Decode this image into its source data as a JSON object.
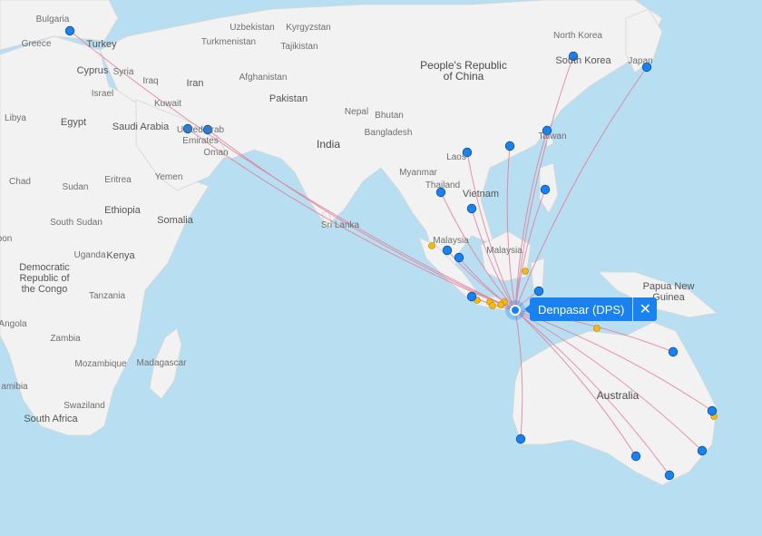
{
  "map": {
    "hub": {
      "name": "Denpasar (DPS)",
      "close_label": "✕"
    },
    "labels": [
      {
        "key": "bulgaria",
        "text": "Bulgaria",
        "cls": ""
      },
      {
        "key": "greece",
        "text": "Greece",
        "cls": ""
      },
      {
        "key": "turkey",
        "text": "Turkey",
        "cls": "country"
      },
      {
        "key": "cyprus",
        "text": "Cyprus",
        "cls": "country"
      },
      {
        "key": "syria",
        "text": "Syria",
        "cls": ""
      },
      {
        "key": "iraq",
        "text": "Iraq",
        "cls": ""
      },
      {
        "key": "israel",
        "text": "Israel",
        "cls": ""
      },
      {
        "key": "iran",
        "text": "Iran",
        "cls": "country"
      },
      {
        "key": "kuwait",
        "text": "Kuwait",
        "cls": ""
      },
      {
        "key": "libya",
        "text": "Libya",
        "cls": ""
      },
      {
        "key": "egypt",
        "text": "Egypt",
        "cls": "country"
      },
      {
        "key": "saudi",
        "text": "Saudi Arabia",
        "cls": "country"
      },
      {
        "key": "uae",
        "text": "United Arab\nEmirates",
        "cls": ""
      },
      {
        "key": "oman",
        "text": "Oman",
        "cls": ""
      },
      {
        "key": "yemen",
        "text": "Yemen",
        "cls": ""
      },
      {
        "key": "uzbekistan",
        "text": "Uzbekistan",
        "cls": ""
      },
      {
        "key": "kyrgyzstan",
        "text": "Kyrgyzstan",
        "cls": ""
      },
      {
        "key": "turkmenistan",
        "text": "Turkmenistan",
        "cls": ""
      },
      {
        "key": "tajikistan",
        "text": "Tajikistan",
        "cls": ""
      },
      {
        "key": "afghanistan",
        "text": "Afghanistan",
        "cls": ""
      },
      {
        "key": "pakistan",
        "text": "Pakistan",
        "cls": "country"
      },
      {
        "key": "nepal",
        "text": "Nepal",
        "cls": ""
      },
      {
        "key": "bhutan",
        "text": "Bhutan",
        "cls": ""
      },
      {
        "key": "india",
        "text": "India",
        "cls": "big"
      },
      {
        "key": "bangladesh",
        "text": "Bangladesh",
        "cls": ""
      },
      {
        "key": "china",
        "text": "People's Republic\nof China",
        "cls": "big"
      },
      {
        "key": "nkorea",
        "text": "North Korea",
        "cls": ""
      },
      {
        "key": "skorea",
        "text": "South Korea",
        "cls": "country"
      },
      {
        "key": "japan",
        "text": "Japan",
        "cls": ""
      },
      {
        "key": "taiwan",
        "text": "Taiwan",
        "cls": ""
      },
      {
        "key": "myanmar",
        "text": "Myanmar",
        "cls": ""
      },
      {
        "key": "laos",
        "text": "Laos",
        "cls": ""
      },
      {
        "key": "thailand",
        "text": "Thailand",
        "cls": ""
      },
      {
        "key": "vietnam",
        "text": "Vietnam",
        "cls": "country"
      },
      {
        "key": "srilanka",
        "text": "Sri Lanka",
        "cls": ""
      },
      {
        "key": "malaysia1",
        "text": "Malaysia",
        "cls": ""
      },
      {
        "key": "malaysia2",
        "text": "Malaysia",
        "cls": ""
      },
      {
        "key": "png",
        "text": "Papua New\nGuinea",
        "cls": "country"
      },
      {
        "key": "australia",
        "text": "Australia",
        "cls": "big"
      },
      {
        "key": "chad",
        "text": "Chad",
        "cls": ""
      },
      {
        "key": "sudan",
        "text": "Sudan",
        "cls": ""
      },
      {
        "key": "eritrea",
        "text": "Eritrea",
        "cls": ""
      },
      {
        "key": "ethiopia",
        "text": "Ethiopia",
        "cls": "country"
      },
      {
        "key": "somalia",
        "text": "Somalia",
        "cls": "country"
      },
      {
        "key": "ssudan",
        "text": "South Sudan",
        "cls": ""
      },
      {
        "key": "uganda",
        "text": "Uganda",
        "cls": ""
      },
      {
        "key": "kenya",
        "text": "Kenya",
        "cls": "country"
      },
      {
        "key": "drc",
        "text": "Democratic\nRepublic of\nthe Congo",
        "cls": "country"
      },
      {
        "key": "tanzania",
        "text": "Tanzania",
        "cls": ""
      },
      {
        "key": "angola",
        "text": "Angola",
        "cls": ""
      },
      {
        "key": "zambia",
        "text": "Zambia",
        "cls": ""
      },
      {
        "key": "mozambique",
        "text": "Mozambique",
        "cls": ""
      },
      {
        "key": "madagascar",
        "text": "Madagascar",
        "cls": ""
      },
      {
        "key": "namibia",
        "text": "amibia",
        "cls": ""
      },
      {
        "key": "swaziland",
        "text": "Swaziland",
        "cls": ""
      },
      {
        "key": "southafrica",
        "text": "South Africa",
        "cls": "country"
      },
      {
        "key": "gabon",
        "text": "bon",
        "cls": ""
      }
    ],
    "colors": {
      "water": "#b8def2",
      "land": "#f2f2f2",
      "route": "#e27a94",
      "airport": "#1a82f0",
      "secondary": "#f2b90f",
      "popup": "#1a82f0"
    },
    "icons": {
      "close": "close-icon"
    }
  }
}
